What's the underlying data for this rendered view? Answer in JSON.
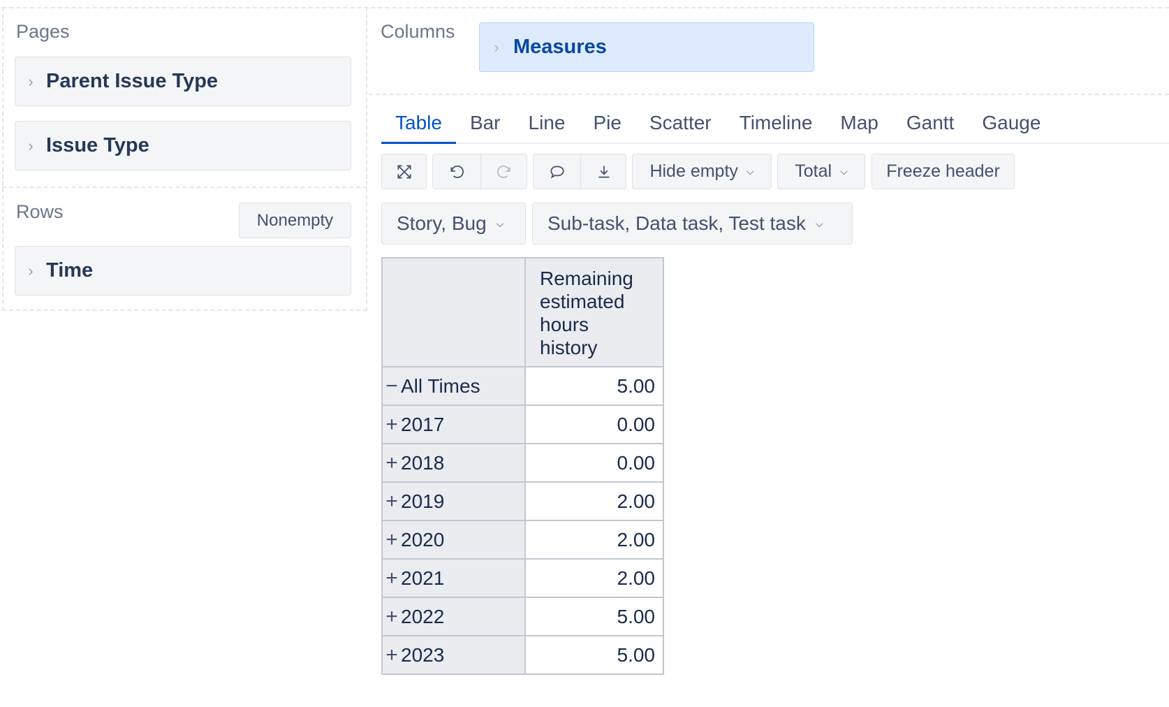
{
  "pages": {
    "title": "Pages",
    "items": [
      {
        "label": "Parent Issue Type"
      },
      {
        "label": "Issue Type"
      }
    ]
  },
  "rows_section": {
    "title": "Rows",
    "nonempty_label": "Nonempty",
    "items": [
      {
        "label": "Time"
      }
    ]
  },
  "columns_section": {
    "title": "Columns",
    "items": [
      {
        "label": "Measures"
      }
    ]
  },
  "tabs": [
    {
      "label": "Table",
      "active": true
    },
    {
      "label": "Bar"
    },
    {
      "label": "Line"
    },
    {
      "label": "Pie"
    },
    {
      "label": "Scatter"
    },
    {
      "label": "Timeline"
    },
    {
      "label": "Map"
    },
    {
      "label": "Gantt"
    },
    {
      "label": "Gauge"
    }
  ],
  "toolbar": {
    "icons": [
      "fullscreen-icon",
      "undo-icon",
      "redo-icon",
      "comment-icon",
      "download-icon"
    ],
    "hide_empty_label": "Hide empty",
    "total_label": "Total",
    "freeze_header_label": "Freeze header"
  },
  "filters": {
    "parent_issue_type": "Story, Bug",
    "issue_type": "Sub-task, Data task, Test task"
  },
  "table": {
    "measure_header": "Remaining estimated hours history",
    "rows": [
      {
        "symbol": "−",
        "label": "All Times",
        "value": "5.00",
        "level": 0
      },
      {
        "symbol": "+",
        "label": "2017",
        "value": "0.00",
        "level": 1
      },
      {
        "symbol": "+",
        "label": "2018",
        "value": "0.00",
        "level": 1
      },
      {
        "symbol": "+",
        "label": "2019",
        "value": "2.00",
        "level": 1
      },
      {
        "symbol": "+",
        "label": "2020",
        "value": "2.00",
        "level": 1
      },
      {
        "symbol": "+",
        "label": "2021",
        "value": "2.00",
        "level": 1
      },
      {
        "symbol": "+",
        "label": "2022",
        "value": "5.00",
        "level": 1
      },
      {
        "symbol": "+",
        "label": "2023",
        "value": "5.00",
        "level": 1
      }
    ]
  },
  "colors": {
    "accent": "#0052cc",
    "measures_bg": "#deebff",
    "panel_bg": "#f4f5f7"
  }
}
